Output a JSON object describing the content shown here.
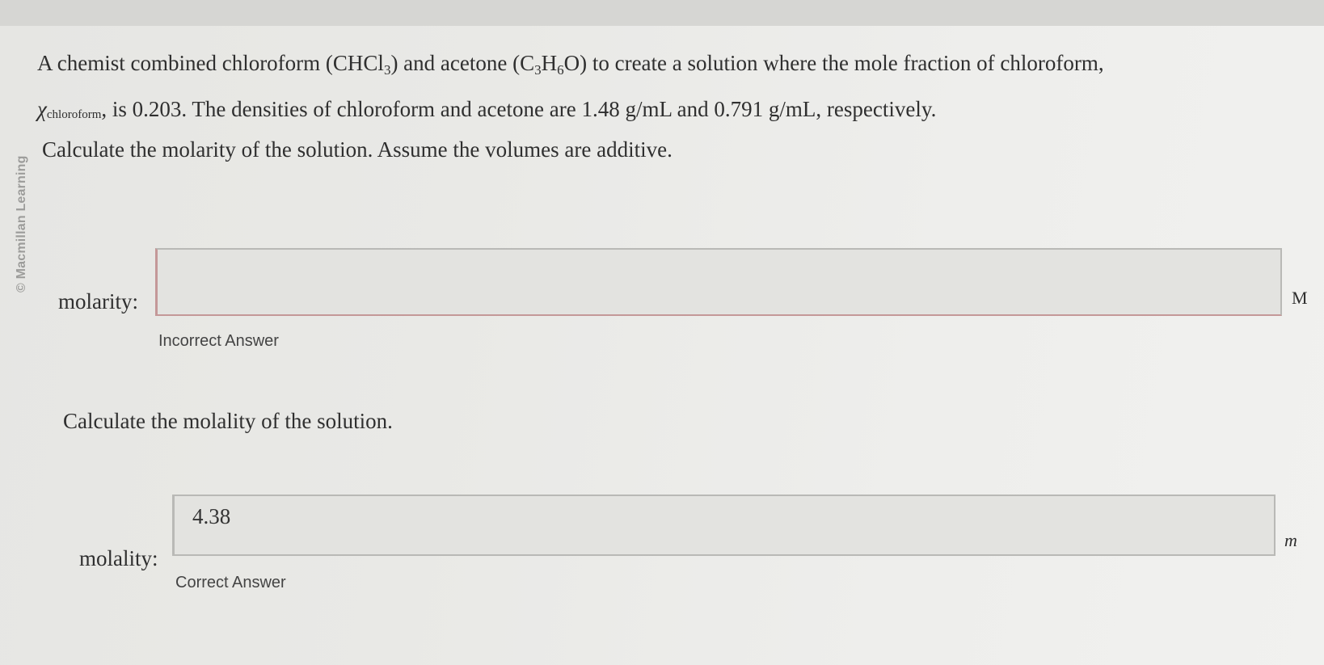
{
  "watermark": "© Macmillan Learning",
  "problem": {
    "p1_before": "A chemist combined chloroform (CHCl",
    "p1_sub1": "3",
    "p1_mid": ") and acetone (C",
    "p1_sub_c": "3",
    "p1_h": "H",
    "p1_sub_h": "6",
    "p1_after": "O) to create a solution where the mole fraction of chloroform,",
    "chi_symbol": "χ",
    "chi_subscript": "chloroform",
    "p2_text": ", is 0.203. The densities of chloroform and acetone are 1.48 g/mL and 0.791 g/mL, respectively."
  },
  "part1": {
    "prompt": "Calculate the molarity of the solution. Assume the volumes are additive.",
    "label": "molarity:",
    "value": "",
    "unit": "M",
    "feedback": "Incorrect Answer"
  },
  "part2": {
    "prompt": "Calculate the molality of the solution.",
    "label": "molality:",
    "value": "4.38",
    "unit": "m",
    "feedback": "Correct Answer"
  }
}
